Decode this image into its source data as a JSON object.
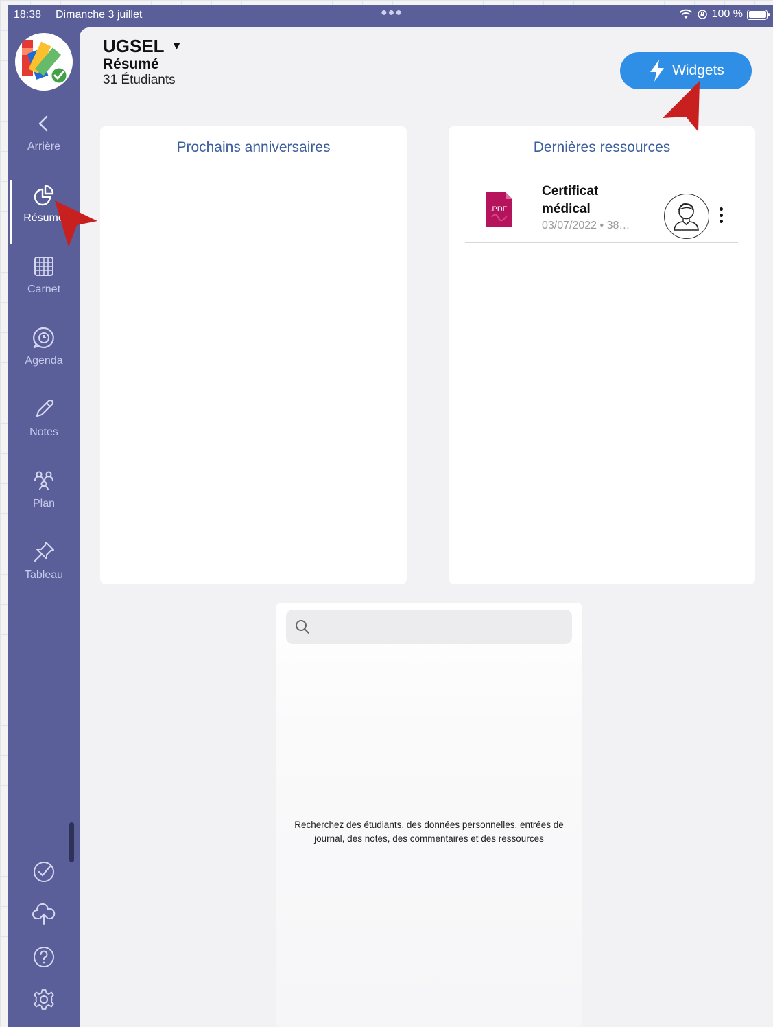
{
  "status_bar": {
    "time": "18:38",
    "date": "Dimanche 3 juillet",
    "battery": "100 %"
  },
  "sidebar": {
    "items": [
      {
        "label": "Arrière",
        "icon": "chevron-left-icon"
      },
      {
        "label": "Résumé",
        "icon": "pie-chart-icon",
        "active": true
      },
      {
        "label": "Carnet",
        "icon": "grid-icon"
      },
      {
        "label": "Agenda",
        "icon": "clock-chat-icon"
      },
      {
        "label": "Notes",
        "icon": "pencil-icon"
      },
      {
        "label": "Plan",
        "icon": "people-icon"
      },
      {
        "label": "Tableau",
        "icon": "pin-icon"
      }
    ],
    "bottom_icons": [
      "check-circle-icon",
      "cloud-upload-icon",
      "help-icon",
      "gear-icon"
    ]
  },
  "header": {
    "title": "UGSEL",
    "subtitle": "Résumé",
    "count": "31 Étudiants"
  },
  "widgets_button": {
    "label": "Widgets"
  },
  "birthdays_card": {
    "title": "Prochains anniversaires"
  },
  "resources_card": {
    "title": "Dernières ressources",
    "items": [
      {
        "name": "Certificat médical",
        "meta": "03/07/2022 • 38…",
        "file_badge": ".PDF"
      }
    ]
  },
  "search": {
    "placeholder": "",
    "help": "Recherchez des étudiants, des données personnelles, entrées de journal, des notes, des commentaires et des ressources"
  },
  "colors": {
    "sidebar": "#5a5f99",
    "accent": "#2f8fe6",
    "card_title": "#3b5e9e",
    "annotation_arrow": "#c8201e",
    "pdf": "#b5135c"
  }
}
